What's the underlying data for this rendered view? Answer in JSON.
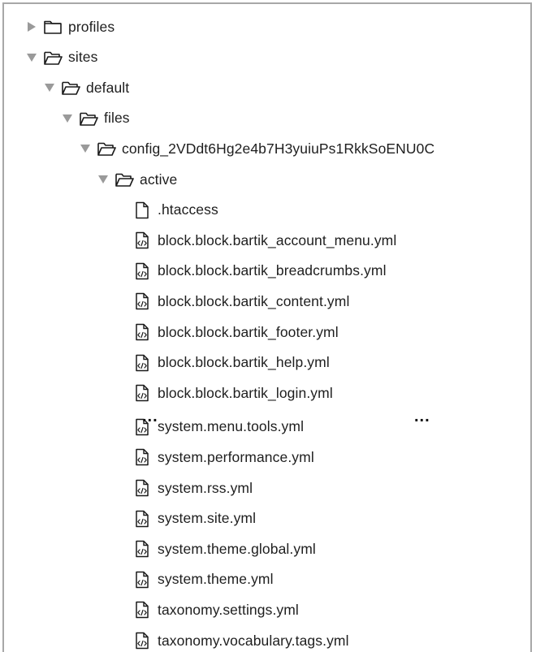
{
  "tree": {
    "rows": [
      {
        "label": "profiles",
        "kind": "folder",
        "expanded": false,
        "depth": 0
      },
      {
        "label": "sites",
        "kind": "folder",
        "expanded": true,
        "depth": 0
      },
      {
        "label": "default",
        "kind": "folder",
        "expanded": true,
        "depth": 1
      },
      {
        "label": "files",
        "kind": "folder",
        "expanded": true,
        "depth": 2
      },
      {
        "label": "config_2VDdt6Hg2e4b7H3yuiuPs1RkkSoENU0C",
        "kind": "folder",
        "expanded": true,
        "depth": 3
      },
      {
        "label": "active",
        "kind": "folder",
        "expanded": true,
        "depth": 4
      },
      {
        "label": ".htaccess",
        "kind": "file-plain",
        "depth": 5
      },
      {
        "label": "block.block.bartik_account_menu.yml",
        "kind": "file-code",
        "depth": 5
      },
      {
        "label": "block.block.bartik_breadcrumbs.yml",
        "kind": "file-code",
        "depth": 5
      },
      {
        "label": "block.block.bartik_content.yml",
        "kind": "file-code",
        "depth": 5
      },
      {
        "label": "block.block.bartik_footer.yml",
        "kind": "file-code",
        "depth": 5
      },
      {
        "label": "block.block.bartik_help.yml",
        "kind": "file-code",
        "depth": 5
      },
      {
        "label": "block.block.bartik_login.yml",
        "kind": "file-code",
        "depth": 5
      },
      {
        "label": "system.menu.tools.yml",
        "kind": "file-code",
        "depth": 5
      },
      {
        "label": "system.performance.yml",
        "kind": "file-code",
        "depth": 5
      },
      {
        "label": "system.rss.yml",
        "kind": "file-code",
        "depth": 5
      },
      {
        "label": "system.site.yml",
        "kind": "file-code",
        "depth": 5
      },
      {
        "label": "system.theme.global.yml",
        "kind": "file-code",
        "depth": 5
      },
      {
        "label": "system.theme.yml",
        "kind": "file-code",
        "depth": 5
      },
      {
        "label": "taxonomy.settings.yml",
        "kind": "file-code",
        "depth": 5
      },
      {
        "label": "taxonomy.vocabulary.tags.yml",
        "kind": "file-code",
        "depth": 5
      }
    ],
    "ellipsis_left": "...",
    "ellipsis_right": "..."
  },
  "colors": {
    "disclosure_triangle": "#9a9a9a",
    "icon_stroke": "#1a1a1a",
    "text": "#1e1e1e",
    "frame_border": "#a8a8a8"
  },
  "icons": {
    "folder_collapsed": "folder-icon",
    "folder_open": "folder-open-icon",
    "file_plain": "file-icon",
    "file_code": "code-file-icon",
    "expanded_toggle": "triangle-down-icon",
    "collapsed_toggle": "triangle-right-icon"
  }
}
